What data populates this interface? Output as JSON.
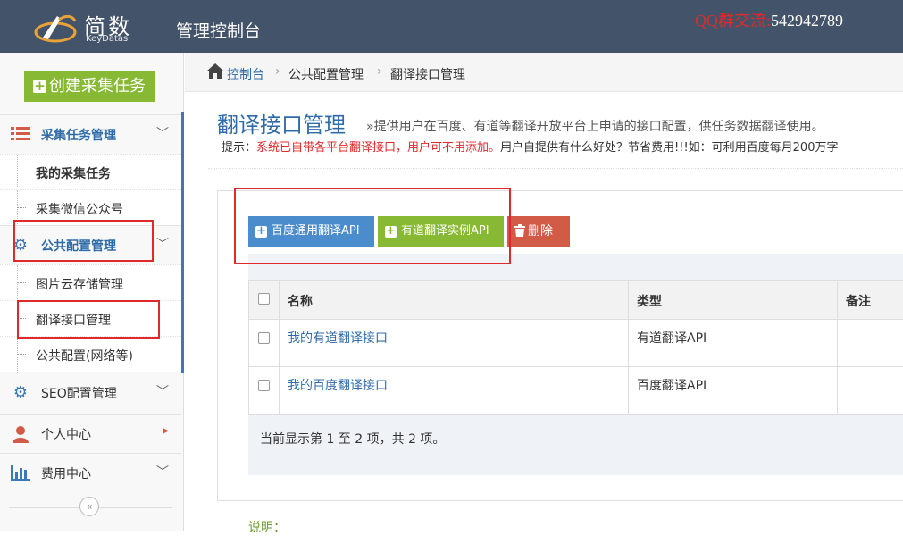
{
  "header": {
    "logo_cn": "简数",
    "logo_en": "KeyDatas",
    "console_title": "管理控制台",
    "qq_label": "QQ群交流:",
    "qq_number": "542942789"
  },
  "sidebar": {
    "create_label": "创建采集任务",
    "items": [
      {
        "label": "采集任务管理"
      },
      {
        "label": "我的采集任务"
      },
      {
        "label": "采集微信公众号"
      },
      {
        "label": "公共配置管理"
      },
      {
        "label": "图片云存储管理"
      },
      {
        "label": "翻译接口管理"
      },
      {
        "label": "公共配置(网络等)"
      },
      {
        "label": "SEO配置管理"
      },
      {
        "label": "个人中心"
      },
      {
        "label": "费用中心"
      }
    ]
  },
  "breadcrumb": {
    "home": "控制台",
    "level1": "公共配置管理",
    "level2": "翻译接口管理"
  },
  "page": {
    "title": "翻译接口管理",
    "description": "»提供用户在百度、有道等翻译开放平台上申请的接口配置，供任务数据翻译使用。",
    "hint_prefix": "提示：",
    "hint_red": "系统已自带各平台翻译接口，用户可不用添加。",
    "hint_rest": "用户自提供有什么好处？节省费用!!!如：可利用百度每月200万字"
  },
  "toolbar": {
    "baidu_label": "百度通用翻译API",
    "youdao_label": "有道翻译实例API",
    "delete_label": "删除"
  },
  "table": {
    "headers": {
      "name": "名称",
      "type": "类型",
      "note": "备注"
    },
    "rows": [
      {
        "name": "我的有道翻译接口",
        "type": "有道翻译API",
        "note": ""
      },
      {
        "name": "我的百度翻译接口",
        "type": "百度翻译API",
        "note": ""
      }
    ],
    "footer": "当前显示第 1 至 2 项，共 2 项。"
  },
  "note_label": "说明："
}
